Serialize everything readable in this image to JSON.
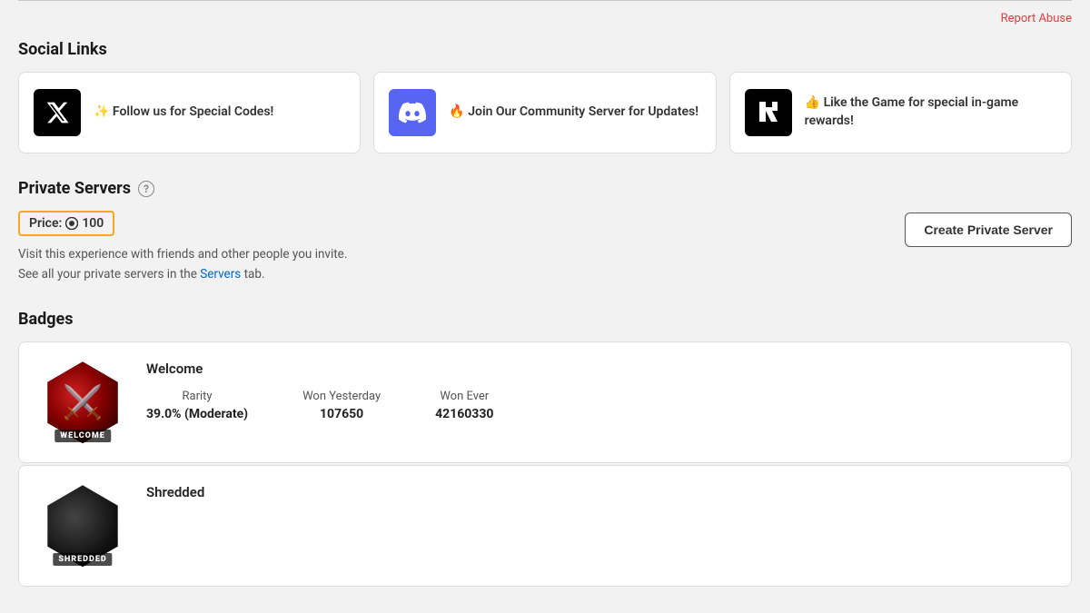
{
  "page": {
    "report_abuse_label": "Report Abuse"
  },
  "social_links": {
    "section_title": "Social Links",
    "cards": [
      {
        "platform": "twitter",
        "emoji": "✨",
        "text": "Follow us for Special Codes!",
        "icon_label": "X"
      },
      {
        "platform": "discord",
        "emoji": "🔥",
        "text": "Join Our Community Server for Updates!",
        "icon_label": "discord"
      },
      {
        "platform": "roblox",
        "emoji": "👍",
        "text": "Like the Game for special in-game rewards!",
        "icon_label": "R"
      }
    ]
  },
  "private_servers": {
    "section_title": "Private Servers",
    "price_label": "Price:",
    "price_amount": "100",
    "description_line1": "Visit this experience with friends and other people you invite.",
    "description_line2": "See all your private servers in the",
    "servers_link_text": "Servers",
    "description_line2_end": "tab.",
    "create_button_label": "Create Private Server"
  },
  "badges": {
    "section_title": "Badges",
    "items": [
      {
        "name": "Welcome",
        "label_overlay": "WELCOME",
        "rarity_label": "Rarity",
        "rarity_value": "39.0% (Moderate)",
        "won_yesterday_label": "Won Yesterday",
        "won_yesterday_value": "107650",
        "won_ever_label": "Won Ever",
        "won_ever_value": "42160330"
      },
      {
        "name": "Shredded",
        "label_overlay": "SHREDDED"
      }
    ]
  }
}
